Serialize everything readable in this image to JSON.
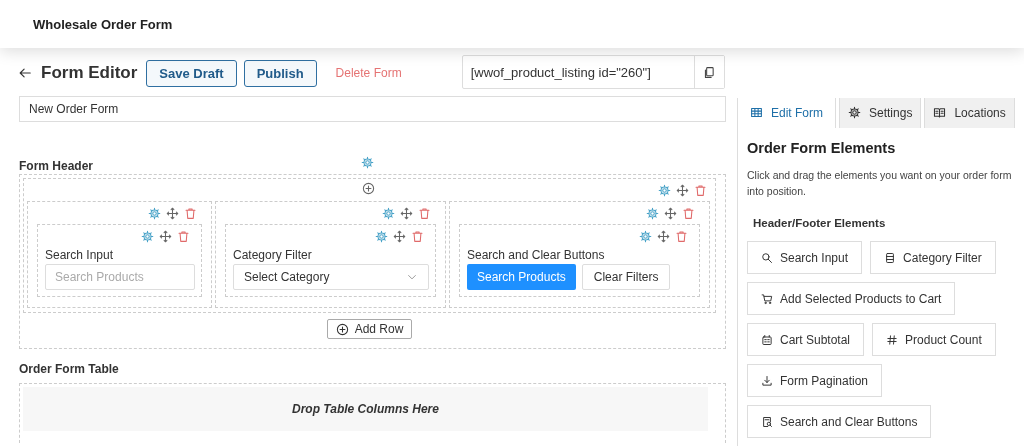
{
  "app_bar": {
    "title": "Wholesale Order Form"
  },
  "toolbar": {
    "title": "Form Editor",
    "buttons": [
      {
        "label": "Save Draft"
      },
      {
        "label": "Publish"
      }
    ],
    "delete_link": "Delete Form",
    "shortcode": "[wwof_product_listing id=\"260\"]"
  },
  "form_name": {
    "value": "New Order Form"
  },
  "form_header": {
    "title": "Form Header",
    "columns": [
      {
        "element": {
          "kind": "search",
          "label": "Search Input",
          "placeholder": "Search Products"
        }
      },
      {
        "element": {
          "kind": "select",
          "label": "Category Filter",
          "value": "Select Category"
        }
      },
      {
        "element": {
          "kind": "buttons",
          "label": "Search and Clear Buttons",
          "buttons": [
            {
              "label": "Search Products",
              "primary": true
            },
            {
              "label": "Clear Filters",
              "primary": false
            }
          ]
        }
      }
    ],
    "add_row": "Add Row"
  },
  "form_table": {
    "title": "Order Form Table",
    "drop_text": "Drop Table Columns Here"
  },
  "sidebar": {
    "tabs": [
      {
        "kind": "table",
        "label": "Edit Form",
        "selected": true
      },
      {
        "kind": "gear",
        "label": "Settings",
        "selected": false
      },
      {
        "kind": "book",
        "label": "Locations",
        "selected": false
      }
    ],
    "heading": "Order Form Elements",
    "description": "Click and drag the elements you want on your order form into position.",
    "section": "Header/Footer Elements",
    "elements": [
      {
        "kind": "search",
        "label": "Search Input"
      },
      {
        "kind": "list",
        "label": "Category Filter"
      },
      {
        "kind": "cart",
        "label": "Add Selected Products to Cart"
      },
      {
        "kind": "calculator",
        "label": "Cart Subtotal"
      },
      {
        "kind": "hash",
        "label": "Product Count"
      },
      {
        "kind": "download",
        "label": "Form Pagination"
      },
      {
        "kind": "search-doc",
        "label": "Search and Clear Buttons"
      }
    ]
  }
}
